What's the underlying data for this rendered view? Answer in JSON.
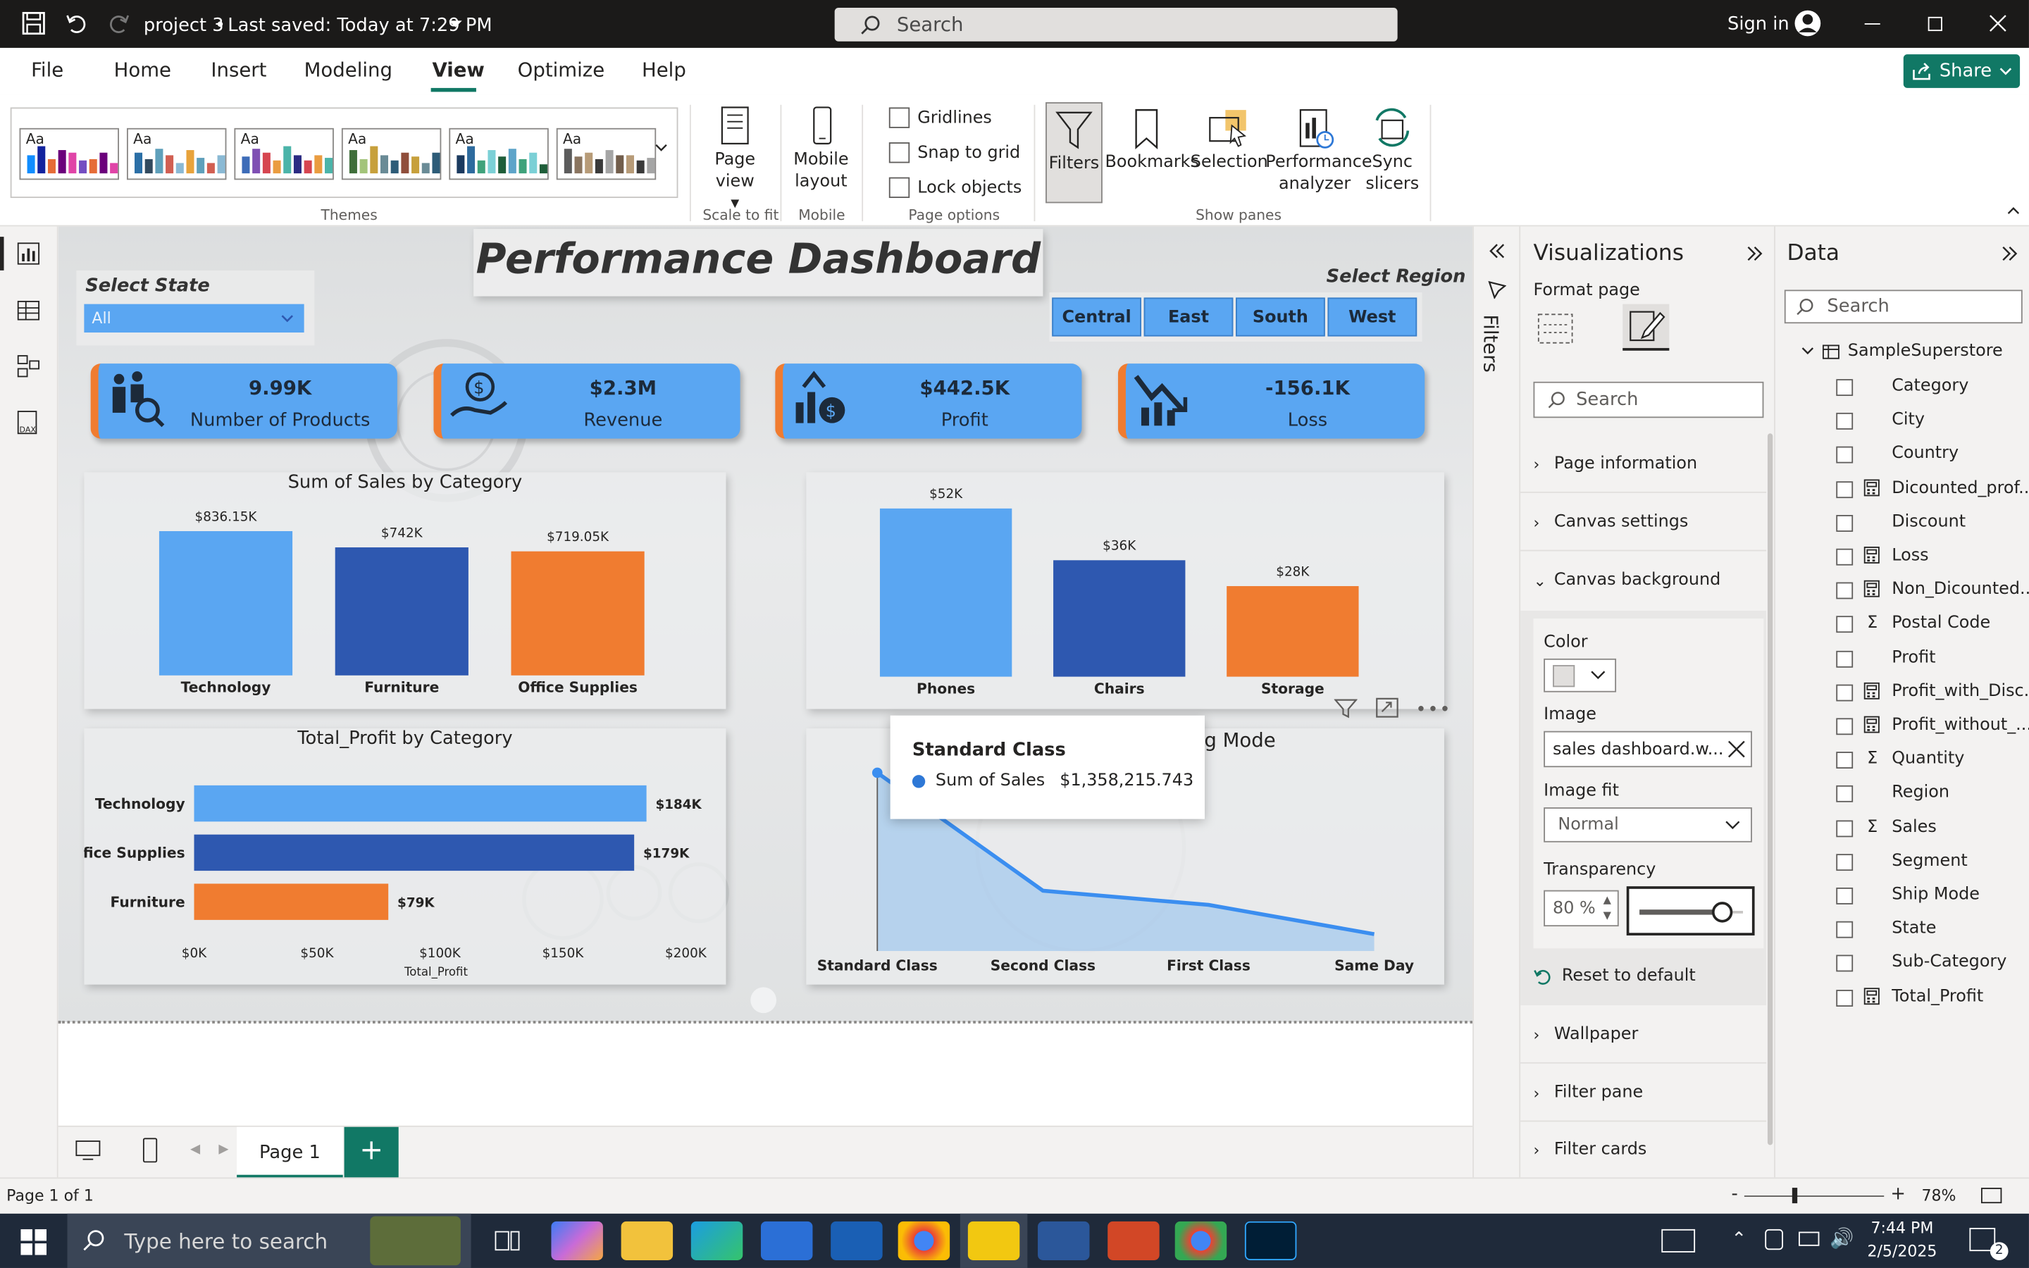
{
  "titlebar": {
    "project": "project 3",
    "saved": "Last saved: Today at 7:29 PM",
    "search_placeholder": "Search",
    "signin": "Sign in"
  },
  "menu": {
    "file": "File",
    "home": "Home",
    "insert": "Insert",
    "modeling": "Modeling",
    "view": "View",
    "optimize": "Optimize",
    "help": "Help",
    "share": "Share"
  },
  "ribbon": {
    "theme_aa": "Aa",
    "themes_label": "Themes",
    "page_view": "Page",
    "page_view2": "view",
    "scale_label": "Scale to fit",
    "mobile_layout": "Mobile",
    "mobile_layout2": "layout",
    "mobile_label": "Mobile",
    "gridlines": "Gridlines",
    "snap": "Snap to grid",
    "lock": "Lock objects",
    "page_options_label": "Page options",
    "filters": "Filters",
    "bookmarks": "Bookmarks",
    "selection": "Selection",
    "perf1": "Performance",
    "perf2": "analyzer",
    "sync1": "Sync",
    "sync2": "slicers",
    "show_panes_label": "Show panes"
  },
  "report": {
    "title": "Performance Dashboard",
    "select_state": "Select State",
    "state_value": "All",
    "select_region": "Select Region",
    "regions": [
      "Central",
      "East",
      "South",
      "West"
    ],
    "kpis": [
      {
        "value": "9.99K",
        "label": "Number of Products"
      },
      {
        "value": "$2.3M",
        "label": "Revenue"
      },
      {
        "value": "$442.5K",
        "label": "Profit"
      },
      {
        "value": "-156.1K",
        "label": "Loss"
      }
    ],
    "tooltip_title": "Standard Class",
    "tooltip_label": "Sum of Sales",
    "tooltip_value": "$1,358,215.743",
    "hidden_title_tail": "ing Mode"
  },
  "chart_data": [
    {
      "type": "bar",
      "title": "Sum of Sales by Category",
      "categories": [
        "Technology",
        "Furniture",
        "Office Supplies"
      ],
      "values": [
        836.15,
        742,
        719.05
      ],
      "labels": [
        "$836.15K",
        "$742K",
        "$719.05K"
      ],
      "colors": [
        "#5aa6f2",
        "#2e58b0",
        "#f07c30"
      ],
      "ylim": [
        0,
        900
      ]
    },
    {
      "type": "bar",
      "title": "",
      "categories": [
        "Phones",
        "Chairs",
        "Storage"
      ],
      "values": [
        52,
        36,
        28
      ],
      "labels": [
        "$52K",
        "$36K",
        "$28K"
      ],
      "colors": [
        "#5aa6f2",
        "#2e58b0",
        "#f07c30"
      ],
      "ylim": [
        0,
        56
      ]
    },
    {
      "type": "bar",
      "title": "Total_Profit by Category",
      "orientation": "horizontal",
      "categories": [
        "Technology",
        "Office Supplies",
        "Furniture"
      ],
      "values": [
        184,
        179,
        79
      ],
      "labels": [
        "$184K",
        "$179K",
        "$79K"
      ],
      "colors": [
        "#5aa6f2",
        "#2e58b0",
        "#f07c30"
      ],
      "ticks": [
        "$0K",
        "$50K",
        "$100K",
        "$150K",
        "$200K"
      ],
      "xlim": [
        0,
        200
      ],
      "xlabel": "Total_Profit"
    },
    {
      "type": "area",
      "title": "",
      "categories": [
        "Standard Class",
        "Second Class",
        "First Class",
        "Same Day"
      ],
      "values": [
        1358.2,
        459.2,
        351.4,
        128.4
      ],
      "ylim": [
        0,
        1400
      ],
      "color": "#5aa6f2"
    }
  ],
  "viz": {
    "title": "Visualizations",
    "format_page": "Format page",
    "search": "Search",
    "page_information": "Page information",
    "canvas_settings": "Canvas settings",
    "canvas_background": "Canvas background",
    "color": "Color",
    "image": "Image",
    "image_value": "sales dashboard.w...",
    "image_fit": "Image fit",
    "image_fit_value": "Normal",
    "transparency": "Transparency",
    "transparency_value": "80 %",
    "transparency_level": 0.8,
    "reset": "Reset to default",
    "wallpaper": "Wallpaper",
    "filter_pane": "Filter pane",
    "filter_cards": "Filter cards"
  },
  "filters_label": "Filters",
  "data": {
    "title": "Data",
    "search": "Search",
    "table": "SampleSuperstore",
    "fields": [
      {
        "name": "Category",
        "icon": ""
      },
      {
        "name": "City",
        "icon": ""
      },
      {
        "name": "Country",
        "icon": ""
      },
      {
        "name": "Dicounted_prof...",
        "icon": "calc"
      },
      {
        "name": "Discount",
        "icon": ""
      },
      {
        "name": "Loss",
        "icon": "calc"
      },
      {
        "name": "Non_Dicounted...",
        "icon": "calc"
      },
      {
        "name": "Postal Code",
        "icon": "sum"
      },
      {
        "name": "Profit",
        "icon": ""
      },
      {
        "name": "Profit_with_Disc...",
        "icon": "calc"
      },
      {
        "name": "Profit_without_...",
        "icon": "calc"
      },
      {
        "name": "Quantity",
        "icon": "sum"
      },
      {
        "name": "Region",
        "icon": ""
      },
      {
        "name": "Sales",
        "icon": "sum"
      },
      {
        "name": "Segment",
        "icon": ""
      },
      {
        "name": "Ship Mode",
        "icon": ""
      },
      {
        "name": "State",
        "icon": ""
      },
      {
        "name": "Sub-Category",
        "icon": ""
      },
      {
        "name": "Total_Profit",
        "icon": "calc"
      }
    ]
  },
  "pages": {
    "page1": "Page 1",
    "add": "+"
  },
  "status": {
    "page": "Page 1 of 1",
    "zoom": "78%",
    "zoom_minus": "-",
    "zoom_plus": "+"
  },
  "taskbar": {
    "search": "Type here to search",
    "time": "7:44 PM",
    "date": "2/5/2025",
    "badge": "2"
  }
}
